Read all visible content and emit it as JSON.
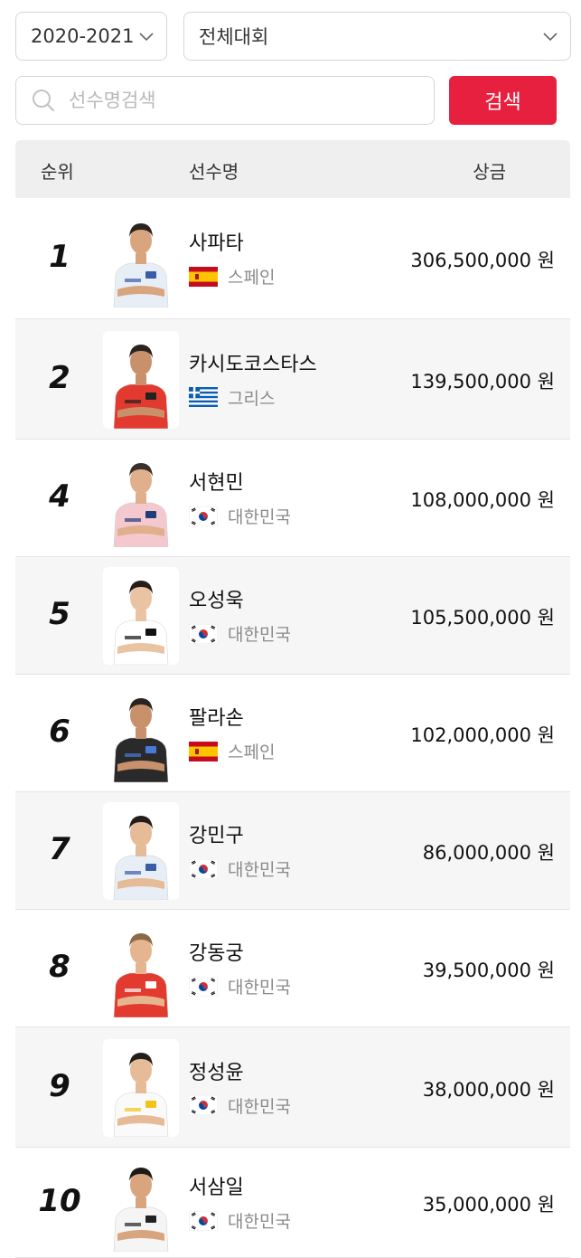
{
  "filters": {
    "season": "2020-2021",
    "event": "전체대회"
  },
  "search": {
    "placeholder": "선수명검색",
    "button_label": "검색"
  },
  "table": {
    "headers": {
      "rank": "순위",
      "name": "선수명",
      "prize": "상금"
    },
    "rows": [
      {
        "rank": "1",
        "name": "사파타",
        "country": "스페인",
        "flag": "spain",
        "prize": "306,500,000 원",
        "shirt": "#e8eef6",
        "skin": "#d9a57e",
        "hair": "#2a2320",
        "accent": "#3b5da8"
      },
      {
        "rank": "2",
        "name": "카시도코스타스",
        "country": "그리스",
        "flag": "greece",
        "prize": "139,500,000 원",
        "shirt": "#e23a2f",
        "skin": "#c9916b",
        "hair": "#2a2320",
        "accent": "#222222"
      },
      {
        "rank": "4",
        "name": "서현민",
        "country": "대한민국",
        "flag": "korea",
        "prize": "108,000,000 원",
        "shirt": "#f3c9cf",
        "skin": "#e0b08c",
        "hair": "#3a302c",
        "accent": "#1e3d7a"
      },
      {
        "rank": "5",
        "name": "오성욱",
        "country": "대한민국",
        "flag": "korea",
        "prize": "105,500,000 원",
        "shirt": "#ffffff",
        "skin": "#e9c3a2",
        "hair": "#241d1a",
        "accent": "#111111"
      },
      {
        "rank": "6",
        "name": "팔라손",
        "country": "스페인",
        "flag": "spain",
        "prize": "102,000,000 원",
        "shirt": "#2a2a2a",
        "skin": "#c9916b",
        "hair": "#2a2320",
        "accent": "#4a7ad8"
      },
      {
        "rank": "7",
        "name": "강민구",
        "country": "대한민국",
        "flag": "korea",
        "prize": "86,000,000 원",
        "shirt": "#e8eef6",
        "skin": "#e6bb98",
        "hair": "#241d1a",
        "accent": "#3b5da8"
      },
      {
        "rank": "8",
        "name": "강동궁",
        "country": "대한민국",
        "flag": "korea",
        "prize": "39,500,000 원",
        "shirt": "#e23a2f",
        "skin": "#e6b48e",
        "hair": "#8a6a45",
        "accent": "#ffffff"
      },
      {
        "rank": "9",
        "name": "정성윤",
        "country": "대한민국",
        "flag": "korea",
        "prize": "38,000,000 원",
        "shirt": "#fafafa",
        "skin": "#e6bb98",
        "hair": "#241d1a",
        "accent": "#f2c318"
      },
      {
        "rank": "10",
        "name": "서삼일",
        "country": "대한민국",
        "flag": "korea",
        "prize": "35,000,000 원",
        "shirt": "#f5f5f5",
        "skin": "#d9a57e",
        "hair": "#1e1a18",
        "accent": "#222222"
      }
    ]
  }
}
